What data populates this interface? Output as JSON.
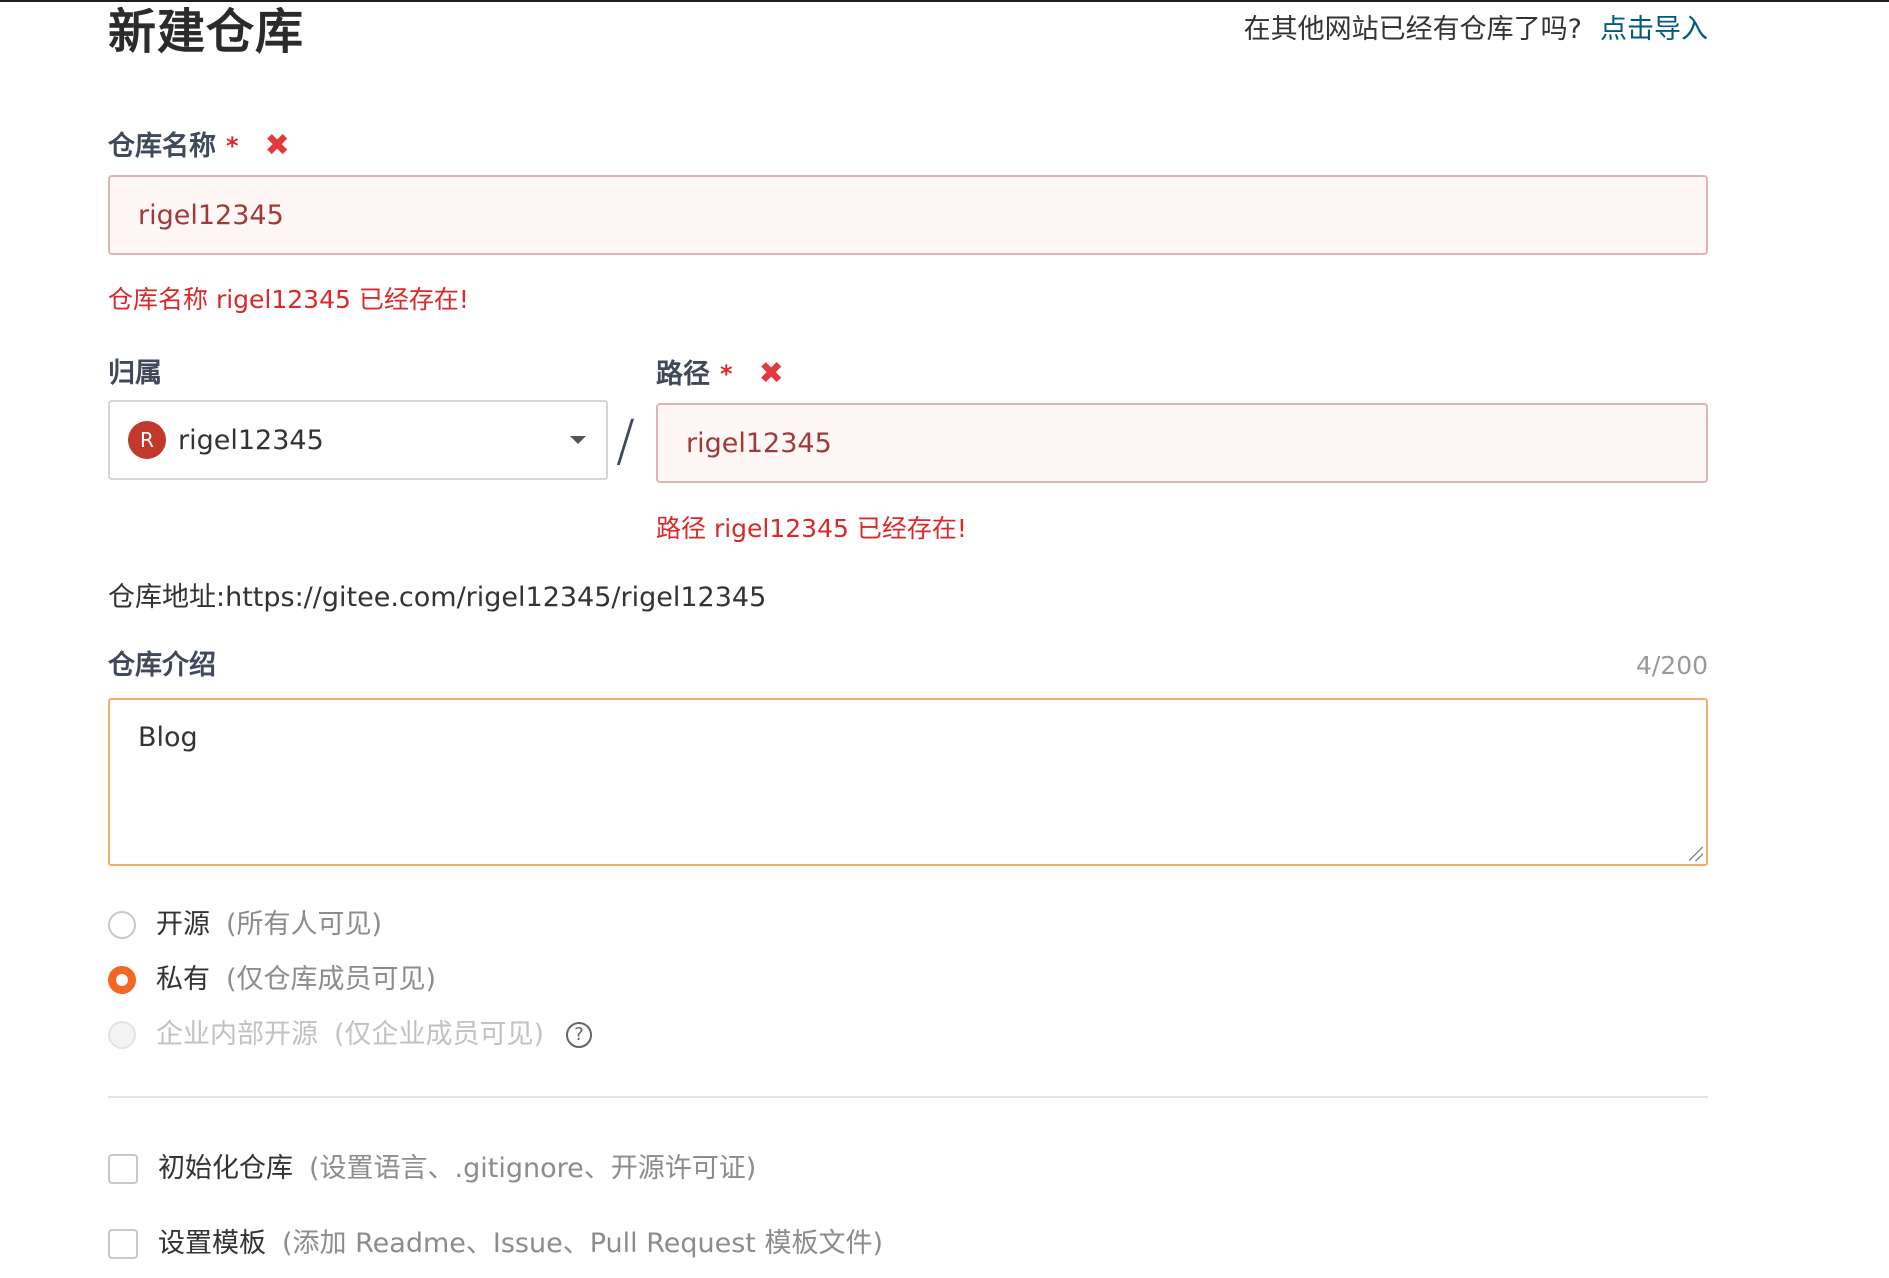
{
  "header": {
    "title": "新建仓库",
    "import_prompt": "在其他网站已经有仓库了吗?",
    "import_link": "点击导入"
  },
  "repo_name": {
    "label": "仓库名称",
    "required_mark": "*",
    "error_mark": "✖",
    "value": "rigel12345",
    "error": "仓库名称 rigel12345 已经存在!"
  },
  "owner": {
    "label": "归属",
    "avatar_letter": "R",
    "value": "rigel12345",
    "avatar_color": "#c0392b"
  },
  "separator": "/",
  "path": {
    "label": "路径",
    "required_mark": "*",
    "error_mark": "✖",
    "value": "rigel12345",
    "error": "路径 rigel12345 已经存在!"
  },
  "address": {
    "text": "仓库地址:https://gitee.com/rigel12345/rigel12345"
  },
  "description": {
    "label": "仓库介绍",
    "counter": "4/200",
    "value": "Blog"
  },
  "visibility": {
    "options": [
      {
        "label": "开源",
        "note": "(所有人可见)",
        "state": "unchecked"
      },
      {
        "label": "私有",
        "note": "(仅仓库成员可见)",
        "state": "checked"
      },
      {
        "label": "企业内部开源",
        "note": "(仅企业成员可见)",
        "state": "disabled"
      }
    ],
    "help_icon": "question-circle-icon",
    "help_glyph": "?"
  },
  "options": {
    "init": {
      "label": "初始化仓库",
      "note": "(设置语言、.gitignore、开源许可证)",
      "checked": false
    },
    "template": {
      "label": "设置模板",
      "note": "(添加 Readme、Issue、Pull Request 模板文件)",
      "checked": false
    }
  },
  "colors": {
    "accent": "#f26722",
    "error": "#db2828",
    "link": "#005980"
  }
}
